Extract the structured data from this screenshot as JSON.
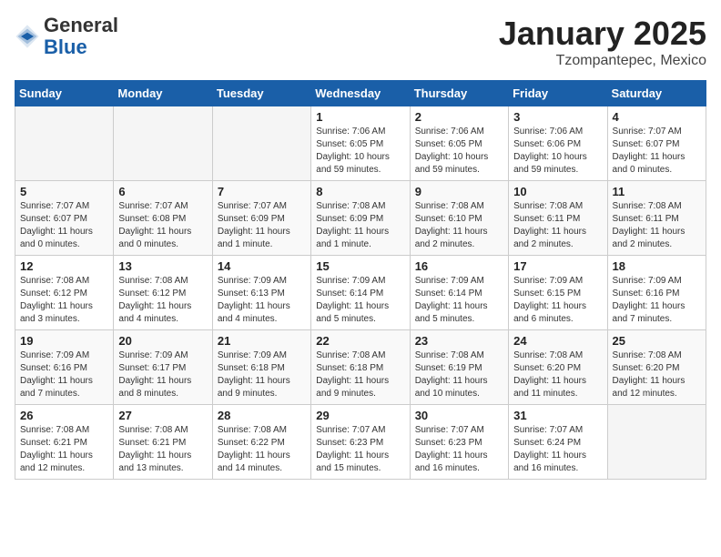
{
  "header": {
    "logo": {
      "general": "General",
      "blue": "Blue"
    },
    "title": "January 2025",
    "location": "Tzompantepec, Mexico"
  },
  "weekdays": [
    "Sunday",
    "Monday",
    "Tuesday",
    "Wednesday",
    "Thursday",
    "Friday",
    "Saturday"
  ],
  "weeks": [
    [
      {
        "day": "",
        "text": ""
      },
      {
        "day": "",
        "text": ""
      },
      {
        "day": "",
        "text": ""
      },
      {
        "day": "1",
        "text": "Sunrise: 7:06 AM\nSunset: 6:05 PM\nDaylight: 10 hours\nand 59 minutes."
      },
      {
        "day": "2",
        "text": "Sunrise: 7:06 AM\nSunset: 6:05 PM\nDaylight: 10 hours\nand 59 minutes."
      },
      {
        "day": "3",
        "text": "Sunrise: 7:06 AM\nSunset: 6:06 PM\nDaylight: 10 hours\nand 59 minutes."
      },
      {
        "day": "4",
        "text": "Sunrise: 7:07 AM\nSunset: 6:07 PM\nDaylight: 11 hours\nand 0 minutes."
      }
    ],
    [
      {
        "day": "5",
        "text": "Sunrise: 7:07 AM\nSunset: 6:07 PM\nDaylight: 11 hours\nand 0 minutes."
      },
      {
        "day": "6",
        "text": "Sunrise: 7:07 AM\nSunset: 6:08 PM\nDaylight: 11 hours\nand 0 minutes."
      },
      {
        "day": "7",
        "text": "Sunrise: 7:07 AM\nSunset: 6:09 PM\nDaylight: 11 hours\nand 1 minute."
      },
      {
        "day": "8",
        "text": "Sunrise: 7:08 AM\nSunset: 6:09 PM\nDaylight: 11 hours\nand 1 minute."
      },
      {
        "day": "9",
        "text": "Sunrise: 7:08 AM\nSunset: 6:10 PM\nDaylight: 11 hours\nand 2 minutes."
      },
      {
        "day": "10",
        "text": "Sunrise: 7:08 AM\nSunset: 6:11 PM\nDaylight: 11 hours\nand 2 minutes."
      },
      {
        "day": "11",
        "text": "Sunrise: 7:08 AM\nSunset: 6:11 PM\nDaylight: 11 hours\nand 2 minutes."
      }
    ],
    [
      {
        "day": "12",
        "text": "Sunrise: 7:08 AM\nSunset: 6:12 PM\nDaylight: 11 hours\nand 3 minutes."
      },
      {
        "day": "13",
        "text": "Sunrise: 7:08 AM\nSunset: 6:12 PM\nDaylight: 11 hours\nand 4 minutes."
      },
      {
        "day": "14",
        "text": "Sunrise: 7:09 AM\nSunset: 6:13 PM\nDaylight: 11 hours\nand 4 minutes."
      },
      {
        "day": "15",
        "text": "Sunrise: 7:09 AM\nSunset: 6:14 PM\nDaylight: 11 hours\nand 5 minutes."
      },
      {
        "day": "16",
        "text": "Sunrise: 7:09 AM\nSunset: 6:14 PM\nDaylight: 11 hours\nand 5 minutes."
      },
      {
        "day": "17",
        "text": "Sunrise: 7:09 AM\nSunset: 6:15 PM\nDaylight: 11 hours\nand 6 minutes."
      },
      {
        "day": "18",
        "text": "Sunrise: 7:09 AM\nSunset: 6:16 PM\nDaylight: 11 hours\nand 7 minutes."
      }
    ],
    [
      {
        "day": "19",
        "text": "Sunrise: 7:09 AM\nSunset: 6:16 PM\nDaylight: 11 hours\nand 7 minutes."
      },
      {
        "day": "20",
        "text": "Sunrise: 7:09 AM\nSunset: 6:17 PM\nDaylight: 11 hours\nand 8 minutes."
      },
      {
        "day": "21",
        "text": "Sunrise: 7:09 AM\nSunset: 6:18 PM\nDaylight: 11 hours\nand 9 minutes."
      },
      {
        "day": "22",
        "text": "Sunrise: 7:08 AM\nSunset: 6:18 PM\nDaylight: 11 hours\nand 9 minutes."
      },
      {
        "day": "23",
        "text": "Sunrise: 7:08 AM\nSunset: 6:19 PM\nDaylight: 11 hours\nand 10 minutes."
      },
      {
        "day": "24",
        "text": "Sunrise: 7:08 AM\nSunset: 6:20 PM\nDaylight: 11 hours\nand 11 minutes."
      },
      {
        "day": "25",
        "text": "Sunrise: 7:08 AM\nSunset: 6:20 PM\nDaylight: 11 hours\nand 12 minutes."
      }
    ],
    [
      {
        "day": "26",
        "text": "Sunrise: 7:08 AM\nSunset: 6:21 PM\nDaylight: 11 hours\nand 12 minutes."
      },
      {
        "day": "27",
        "text": "Sunrise: 7:08 AM\nSunset: 6:21 PM\nDaylight: 11 hours\nand 13 minutes."
      },
      {
        "day": "28",
        "text": "Sunrise: 7:08 AM\nSunset: 6:22 PM\nDaylight: 11 hours\nand 14 minutes."
      },
      {
        "day": "29",
        "text": "Sunrise: 7:07 AM\nSunset: 6:23 PM\nDaylight: 11 hours\nand 15 minutes."
      },
      {
        "day": "30",
        "text": "Sunrise: 7:07 AM\nSunset: 6:23 PM\nDaylight: 11 hours\nand 16 minutes."
      },
      {
        "day": "31",
        "text": "Sunrise: 7:07 AM\nSunset: 6:24 PM\nDaylight: 11 hours\nand 16 minutes."
      },
      {
        "day": "",
        "text": ""
      }
    ]
  ]
}
